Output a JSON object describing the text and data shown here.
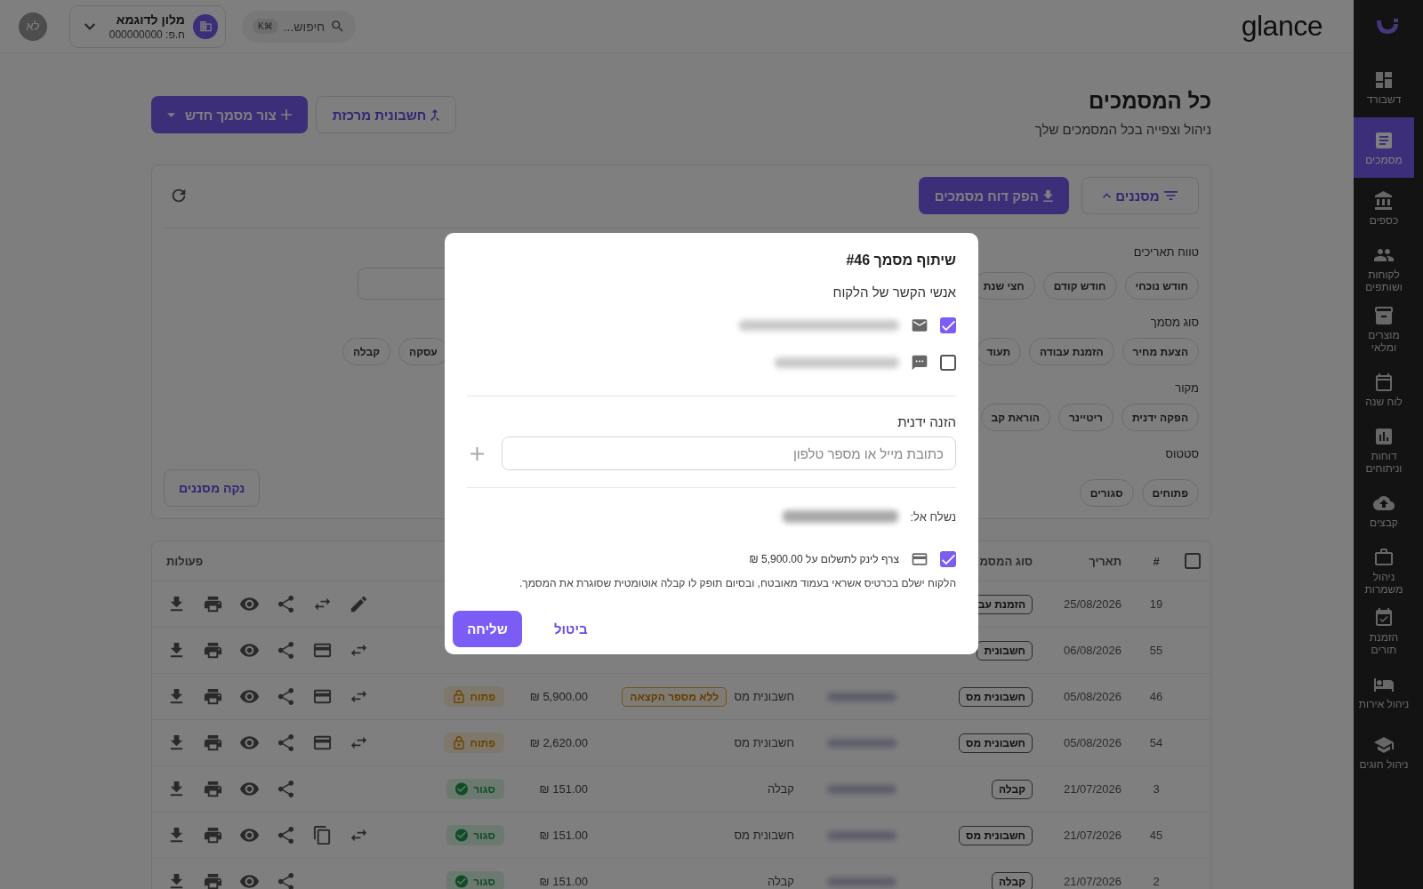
{
  "sidebar": {
    "items": [
      {
        "label": "דשבורד",
        "selected": false
      },
      {
        "label": "מסמכים",
        "selected": true
      },
      {
        "label": "כספים",
        "selected": false
      },
      {
        "label": "לקוחות ושותפים",
        "selected": false
      },
      {
        "label": "מוצרים ומלאי",
        "selected": false
      },
      {
        "label": "לוח שנה",
        "selected": false
      },
      {
        "label": "דוחות וניתוחים",
        "selected": false
      },
      {
        "label": "קבצים",
        "selected": false
      },
      {
        "label": "ניהול משמרות",
        "selected": false
      },
      {
        "label": "הזמנת תורים",
        "selected": false
      },
      {
        "label": "ניהול אירות",
        "selected": false
      },
      {
        "label": "ניהול חוגים",
        "selected": false
      }
    ]
  },
  "topbar": {
    "logo": "glance",
    "search": {
      "placeholder": "חיפוש...",
      "shortcut": "⌘K"
    },
    "business": {
      "name": "מלון לדוגמא",
      "id": "ח.פ: 000000000"
    },
    "avatar": "לא"
  },
  "header": {
    "title": "כל המסמכים",
    "subtitle": "ניהול וצפייה בכל המסמכים שלך",
    "buttons": [
      {
        "label": "חשבונית מרכזת",
        "kind": "outline"
      },
      {
        "label": "צור מסמך חדש",
        "kind": "primary"
      }
    ]
  },
  "filters": {
    "toggle": "מסננים",
    "expanded": true,
    "report": "הפק דוח מסמכים",
    "clear": "נקה מסננים",
    "groups": [
      {
        "label": "טווח תאריכים",
        "has_date_field": true,
        "chips": [
          {
            "label": "חודש נוכחי",
            "selected": false
          },
          {
            "label": "חודש קודם",
            "selected": false
          },
          {
            "label": "חצי שנת",
            "selected": false
          }
        ]
      },
      {
        "label": "סוג מסמך",
        "chips": [
          {
            "label": "הצעת מחיר",
            "selected": false
          },
          {
            "label": "הזמנת עבודה",
            "selected": false
          },
          {
            "label": "תעוד",
            "selected": false
          }
        ],
        "end_chips": [
          {
            "label": "עסקה",
            "selected": false
          },
          {
            "label": "קבלה",
            "selected": false
          }
        ]
      },
      {
        "label": "מקור",
        "chips": [
          {
            "label": "הפקה ידנית",
            "selected": false
          },
          {
            "label": "ריטיינר",
            "selected": false
          },
          {
            "label": "הוראת קב",
            "selected": false
          }
        ]
      },
      {
        "label": "סטטוס",
        "chips": [
          {
            "label": "פתוחים",
            "selected": false
          },
          {
            "label": "סגורים",
            "selected": false
          }
        ]
      }
    ]
  },
  "table": {
    "header": {
      "select_all_checked": false,
      "number": "#",
      "date": "תאריך",
      "type": "סוג המסמ",
      "actions": "פעולות"
    },
    "rows": [
      {
        "number": "19",
        "date": "25/08/2026",
        "type": "הזמנת עב",
        "actions": [
          {
            "kind": "download"
          },
          {
            "kind": "print"
          },
          {
            "kind": "view"
          },
          {
            "kind": "share"
          },
          {
            "kind": "swap"
          },
          {
            "kind": "edit"
          }
        ]
      },
      {
        "number": "55",
        "date": "06/08/2026",
        "type": "חשבונית",
        "actions": [
          {
            "kind": "download"
          },
          {
            "kind": "print"
          },
          {
            "kind": "view"
          },
          {
            "kind": "share"
          },
          {
            "kind": "card"
          },
          {
            "kind": "swap"
          }
        ]
      },
      {
        "number": "46",
        "date": "05/08/2026",
        "type": "חשבונית מס",
        "customer_blurred": true,
        "doc_type": "חשבונית מס",
        "allocation": "ללא מספר הקצאה",
        "amount": "5,900.00 ₪",
        "status": {
          "label": "פתוח",
          "kind": "open"
        },
        "actions": [
          {
            "kind": "download"
          },
          {
            "kind": "print"
          },
          {
            "kind": "view"
          },
          {
            "kind": "share"
          },
          {
            "kind": "card"
          },
          {
            "kind": "swap"
          }
        ]
      },
      {
        "number": "54",
        "date": "05/08/2026",
        "type": "חשבונית מס",
        "customer_blurred": true,
        "doc_type": "חשבונית מס",
        "amount": "2,620.00 ₪",
        "status": {
          "label": "פתוח",
          "kind": "open"
        },
        "actions": [
          {
            "kind": "download"
          },
          {
            "kind": "print"
          },
          {
            "kind": "view"
          },
          {
            "kind": "share"
          },
          {
            "kind": "card"
          },
          {
            "kind": "swap"
          }
        ]
      },
      {
        "number": "3",
        "date": "21/07/2026",
        "type": "קבלה",
        "customer_blurred": true,
        "doc_type": "קבלה",
        "amount": "151.00 ₪",
        "status": {
          "label": "סגור",
          "kind": "closed"
        },
        "actions": [
          {
            "kind": "download"
          },
          {
            "kind": "print"
          },
          {
            "kind": "view"
          },
          {
            "kind": "share"
          }
        ]
      },
      {
        "number": "45",
        "date": "21/07/2026",
        "type": "חשבונית מס",
        "customer_blurred": true,
        "doc_type": "חשבונית מס",
        "amount": "151.00 ₪",
        "status": {
          "label": "סגור",
          "kind": "closed"
        },
        "actions": [
          {
            "kind": "download"
          },
          {
            "kind": "print"
          },
          {
            "kind": "view"
          },
          {
            "kind": "share"
          },
          {
            "kind": "copy"
          },
          {
            "kind": "swap"
          }
        ]
      },
      {
        "number": "2",
        "date": "21/07/2026",
        "type": "קבלה",
        "customer_blurred": true,
        "doc_type": "קבלה",
        "amount": "151.00 ₪",
        "status": {
          "label": "סגור",
          "kind": "closed"
        },
        "actions": [
          {
            "kind": "download"
          },
          {
            "kind": "print"
          },
          {
            "kind": "view"
          },
          {
            "kind": "share"
          }
        ]
      }
    ]
  },
  "modal": {
    "title": "שיתוף מסמך #46",
    "contacts_label": "אנשי הקשר של הלקוח",
    "contacts": [
      {
        "kind": "email",
        "checked": true
      },
      {
        "kind": "sms",
        "checked": false
      }
    ],
    "manual_label": "הזנה ידנית",
    "manual_placeholder": "כתובת מייל או מספר טלפון",
    "sent_to_label": "נשלח אל:",
    "payment_link": {
      "checked": true,
      "label": "צרף לינק לתשלום על 5,900.00 ₪"
    },
    "note": "הלקוח ישלם בכרטיס אשראי בעמוד מאובטח, ובסיום תופק לו קבלה אוטומטית שסוגרת את המסמך.",
    "send": "שליחה",
    "cancel": "ביטול"
  }
}
